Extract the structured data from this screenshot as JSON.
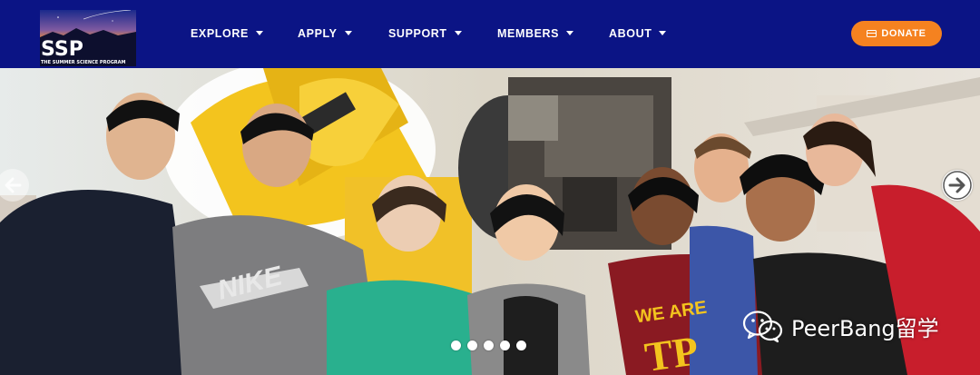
{
  "logo": {
    "title": "SSP",
    "subtitle": "THE SUMMER SCIENCE PROGRAM"
  },
  "nav": {
    "items": [
      {
        "label": "EXPLORE"
      },
      {
        "label": "APPLY"
      },
      {
        "label": "SUPPORT"
      },
      {
        "label": "MEMBERS"
      },
      {
        "label": "ABOUT"
      }
    ],
    "donate_label": "DONATE"
  },
  "colors": {
    "nav_background": "#0b1485",
    "donate_button": "#f58220",
    "telescope_yellow": "#f3c41e"
  },
  "hero": {
    "slides_count": 5,
    "active_slide": 1,
    "shirt_texts": [
      "NIKE",
      "WE ARE",
      "TP"
    ]
  },
  "watermark": {
    "text": "PeerBang留学"
  },
  "icons": [
    "caret-down-icon",
    "credit-card-icon",
    "arrow-left-icon",
    "arrow-right-icon",
    "wechat-icon"
  ]
}
